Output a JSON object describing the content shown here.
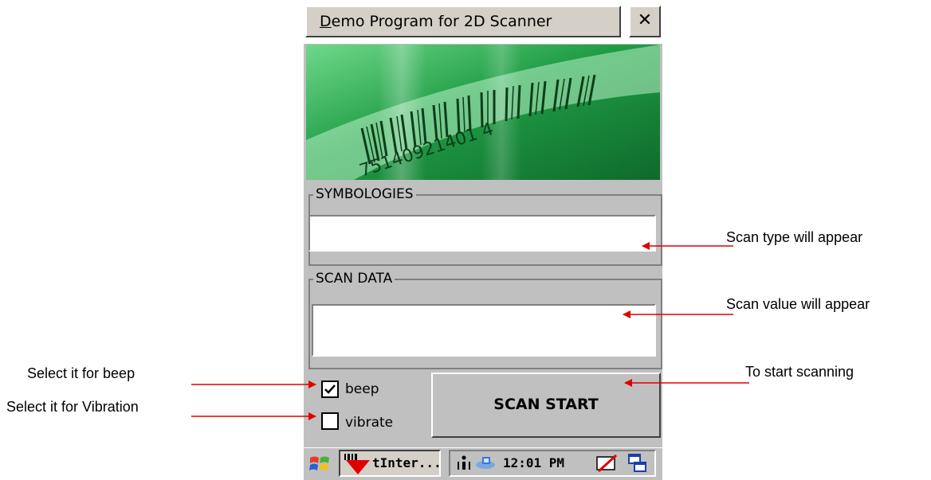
{
  "window": {
    "title": "Demo Program for 2D Scanner",
    "title_mnemonic": "D",
    "title_rest": "emo Program for 2D Scanner",
    "close_label": "✕"
  },
  "banner": {
    "barcode_digits": "75140921401 4"
  },
  "symbologies": {
    "label": "SYMBOLOGIES",
    "value": ""
  },
  "scan_data": {
    "label": "SCAN DATA",
    "value": ""
  },
  "options": {
    "beep_label": "beep",
    "beep_checked": true,
    "vibrate_label": "vibrate",
    "vibrate_checked": false
  },
  "scan_button": {
    "label": "SCAN START"
  },
  "taskbar": {
    "app_label": "tInter...",
    "clock": "12:01 PM"
  },
  "annotations": {
    "scan_type": "Scan type will appear",
    "scan_value": "Scan value will appear",
    "start_scanning": "To start scanning",
    "beep": "Select it for beep",
    "vibration": "Select it for Vibration"
  },
  "colors": {
    "arrow": "#e00000",
    "window_bg": "#c0c0c0",
    "banner_green": "#2fa84f"
  }
}
